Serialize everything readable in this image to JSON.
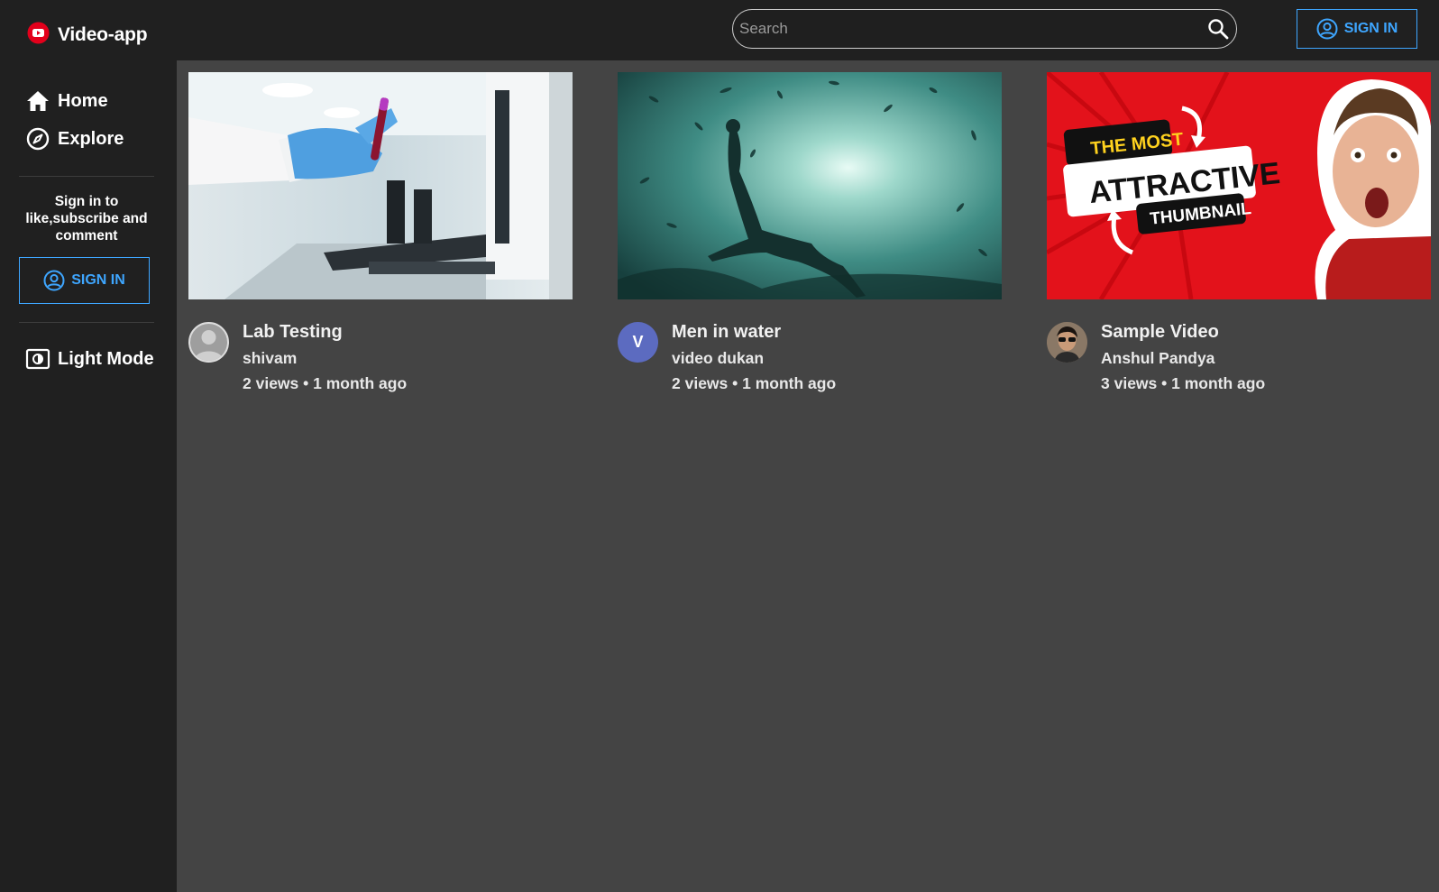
{
  "app": {
    "name": "Video-app",
    "brand_color": "#ff0000",
    "accent_color": "#3ea6ff"
  },
  "topbar": {
    "search_placeholder": "Search",
    "search_icon": "search-icon",
    "signin_label": "SIGN IN"
  },
  "sidebar": {
    "items": [
      {
        "label": "Home",
        "icon": "home-icon"
      },
      {
        "label": "Explore",
        "icon": "compass-icon"
      }
    ],
    "signin_hint": "Sign in to like,subscribe and comment",
    "signin_label": "SIGN IN",
    "mode_toggle": {
      "label": "Light Mode",
      "icon": "brightness-icon"
    }
  },
  "videos": [
    {
      "title": "Lab Testing",
      "channel": "shivam",
      "views": "2 views",
      "age": "1 month ago",
      "avatar": "default-avatar"
    },
    {
      "title": "Men in water",
      "channel": "video dukan",
      "views": "2 views",
      "age": "1 month ago",
      "avatar_letter": "V",
      "avatar_color": "#5c6bc0"
    },
    {
      "title": "Sample Video",
      "channel": "Anshul Pandya",
      "views": "3 views",
      "age": "1 month ago",
      "avatar": "photo-avatar"
    }
  ],
  "thumbnail_text": {
    "line1": "THE MOST",
    "line2": "ATTRACTIVE",
    "line3": "THUMBNAIL"
  }
}
